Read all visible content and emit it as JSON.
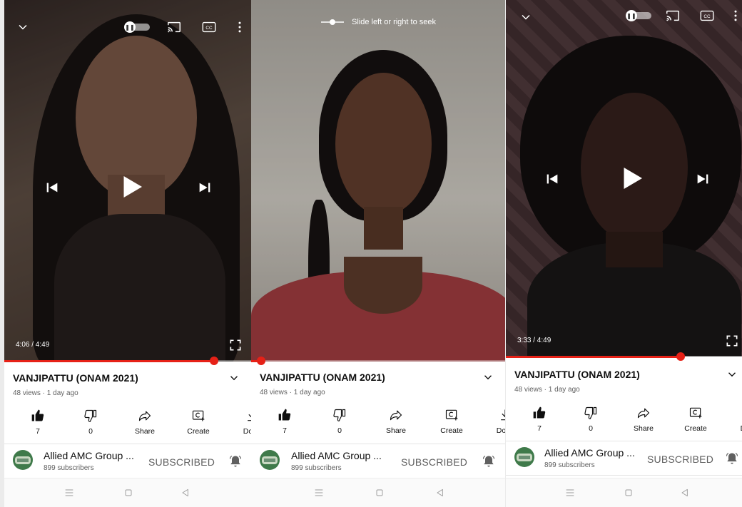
{
  "colors": {
    "accent": "#e62117",
    "text": "#0f0f0f",
    "muted": "#606060"
  },
  "panels": [
    {
      "player": {
        "current_time": "4:06",
        "duration": "4:49",
        "time_text": "4:06 / 4:49",
        "progress": 0.85,
        "seek_hint": ""
      },
      "video": {
        "title": "VANJIPATTU (ONAM 2021)",
        "meta": "48 views · 1 day ago"
      },
      "actions": [
        {
          "icon": "like-filled-icon",
          "label": "7"
        },
        {
          "icon": "dislike-icon",
          "label": "0"
        },
        {
          "icon": "share-icon",
          "label": "Share"
        },
        {
          "icon": "create-icon",
          "label": "Create"
        },
        {
          "icon": "download-icon",
          "label": "Dowr"
        }
      ],
      "channel": {
        "name": "Allied AMC Group ...",
        "subscribers": "899 subscribers",
        "subscribe_label": "SUBSCRIBED"
      }
    },
    {
      "player": {
        "current_time": "",
        "duration": "",
        "time_text": "",
        "progress": 0.04,
        "seek_hint": "Slide left or right to seek"
      },
      "video": {
        "title": "VANJIPATTU (ONAM 2021)",
        "meta": "48 views · 1 day ago"
      },
      "actions": [
        {
          "icon": "like-filled-icon",
          "label": "7"
        },
        {
          "icon": "dislike-icon",
          "label": "0"
        },
        {
          "icon": "share-icon",
          "label": "Share"
        },
        {
          "icon": "create-icon",
          "label": "Create"
        },
        {
          "icon": "download-icon",
          "label": "Dowr"
        }
      ],
      "channel": {
        "name": "Allied AMC Group ...",
        "subscribers": "899 subscribers",
        "subscribe_label": "SUBSCRIBED"
      }
    },
    {
      "player": {
        "current_time": "3:33",
        "duration": "4:49",
        "time_text": "3:33 / 4:49",
        "progress": 0.74,
        "seek_hint": ""
      },
      "video": {
        "title": "VANJIPATTU (ONAM 2021)",
        "meta": "48 views · 1 day ago"
      },
      "actions": [
        {
          "icon": "like-filled-icon",
          "label": "7"
        },
        {
          "icon": "dislike-icon",
          "label": "0"
        },
        {
          "icon": "share-icon",
          "label": "Share"
        },
        {
          "icon": "create-icon",
          "label": "Create"
        },
        {
          "icon": "download-icon",
          "label": "Dov"
        }
      ],
      "channel": {
        "name": "Allied AMC Group ...",
        "subscribers": "899 subscribers",
        "subscribe_label": "SUBSCRIBED"
      }
    }
  ]
}
